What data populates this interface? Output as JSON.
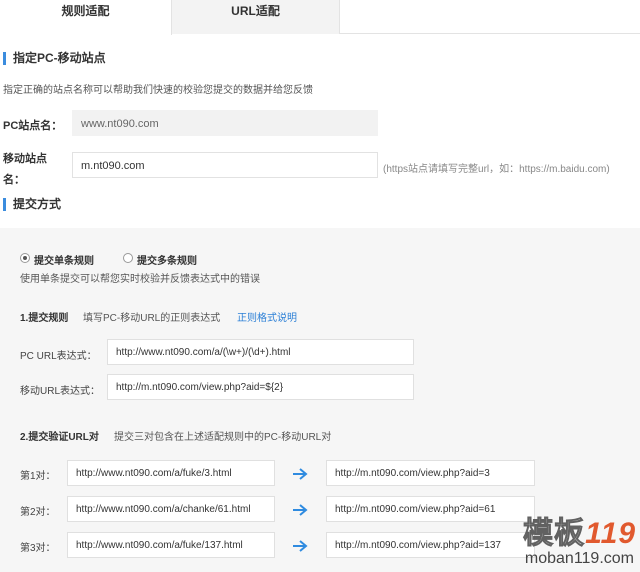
{
  "tabs": {
    "rule": "规则适配",
    "url": "URL适配"
  },
  "site": {
    "title": "指定PC-移动站点",
    "desc": "指定正确的站点名称可以帮助我们快速的校验您提交的数据并给您反馈",
    "pc_label": "PC站点名：",
    "pc_value": "www.nt090.com",
    "mobile_label_1": "移动站点",
    "mobile_label_2": "名：",
    "mobile_value": "m.nt090.com",
    "mobile_hint": "(https站点请填写完整url，如：https://m.baidu.com)"
  },
  "submit": {
    "title": "提交方式",
    "radio_single": "提交单条规则",
    "radio_multi": "提交多条规则",
    "single_selected": true,
    "radio_desc": "使用单条提交可以帮您实时校验并反馈表达式中的错误",
    "rule_title": "1.提交规则",
    "rule_desc": "填写PC-移动URL的正则表达式",
    "rule_link": "正则格式说明",
    "pc_expr_label": "PC  URL表达式：",
    "pc_expr_value": "http://www.nt090.com/a/(\\w+)/(\\d+).html",
    "mobile_expr_label": "移动URL表达式：",
    "mobile_expr_value": "http://m.nt090.com/view.php?aid=${2}",
    "verify_title": "2.提交验证URL对",
    "verify_desc": "提交三对包含在上述适配规则中的PC-移动URL对",
    "pairs": [
      {
        "label": "第1对：",
        "pc": "http://www.nt090.com/a/fuke/3.html",
        "mobile": "http://m.nt090.com/view.php?aid=3"
      },
      {
        "label": "第2对：",
        "pc": "http://www.nt090.com/a/chanke/61.html",
        "mobile": "http://m.nt090.com/view.php?aid=61"
      },
      {
        "label": "第3对：",
        "pc": "http://www.nt090.com/a/fuke/137.html",
        "mobile": "http://m.nt090.com/view.php?aid=137"
      }
    ]
  },
  "watermark": {
    "brand_cn": "模板",
    "brand_num": "119",
    "url": "moban119.com"
  },
  "colors": {
    "accent": "#3b8cde",
    "link": "#2b7fd6",
    "arrow": "#2f8be0",
    "watermark": "#e04c1e"
  }
}
